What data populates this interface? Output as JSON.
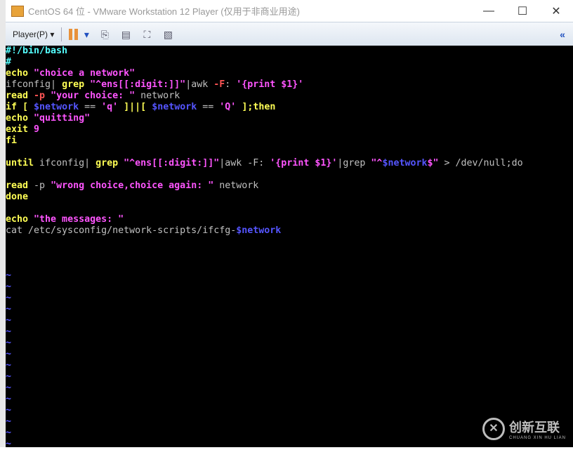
{
  "window": {
    "title": "CentOS 64 位 - VMware Workstation 12 Player (仅用于非商业用途)",
    "minimize": "—",
    "maximize": "☐",
    "close": "✕"
  },
  "toolbar": {
    "player_menu": "Player(P) ▾",
    "pause_dropdown": "▾",
    "send_keys": "⎘",
    "removable": "▤",
    "fullscreen": "⛶",
    "unity": "▧",
    "collapse": "«"
  },
  "editor": {
    "lines": [
      [
        [
          "c",
          "#!/bin/bash"
        ]
      ],
      [
        [
          "c",
          "#"
        ]
      ],
      [
        [
          "y",
          "echo "
        ],
        [
          "m",
          "\"choice a network\""
        ]
      ],
      [
        [
          "g",
          "ifconfig| "
        ],
        [
          "y",
          "grep "
        ],
        [
          "m",
          "\"^ens[[:digit:]]\""
        ],
        [
          "g",
          "|awk "
        ],
        [
          "r",
          "-F"
        ],
        [
          "g",
          ": "
        ],
        [
          "m",
          "'{print $1}'"
        ]
      ],
      [
        [
          "y",
          "read "
        ],
        [
          "r",
          "-p "
        ],
        [
          "m",
          "\"your choice: \""
        ],
        [
          "g",
          " network"
        ]
      ],
      [
        [
          "y",
          "if "
        ],
        [
          "y",
          "[ "
        ],
        [
          "b",
          "$network"
        ],
        [
          "g",
          " == "
        ],
        [
          "m",
          "'q'"
        ],
        [
          "y",
          " ]||[ "
        ],
        [
          "b",
          "$network"
        ],
        [
          "g",
          " == "
        ],
        [
          "m",
          "'Q'"
        ],
        [
          "y",
          " ];then"
        ]
      ],
      [
        [
          "y",
          "echo "
        ],
        [
          "m",
          "\"quitting\""
        ]
      ],
      [
        [
          "y",
          "exit "
        ],
        [
          "m",
          "9"
        ]
      ],
      [
        [
          "y",
          "fi"
        ]
      ],
      [],
      [
        [
          "y",
          "until "
        ],
        [
          "g",
          "ifconfig| "
        ],
        [
          "y",
          "grep "
        ],
        [
          "m",
          "\"^ens[[:digit:]]\""
        ],
        [
          "g",
          "|awk -F: "
        ],
        [
          "m",
          "'{print $1}'"
        ],
        [
          "g",
          "|grep "
        ],
        [
          "m",
          "\"^"
        ],
        [
          "b",
          "$network"
        ],
        [
          "m",
          "$\""
        ],
        [
          "g",
          " > /dev/null;do"
        ]
      ],
      [],
      [
        [
          "y",
          "read "
        ],
        [
          "g",
          "-p "
        ],
        [
          "m",
          "\"wrong choice,choice again: \""
        ],
        [
          "g",
          " network"
        ]
      ],
      [
        [
          "y",
          "done"
        ]
      ],
      [],
      [
        [
          "y",
          "echo "
        ],
        [
          "m",
          "\"the messages: \""
        ]
      ],
      [
        [
          "g",
          "cat /etc/sysconfig/network-scripts/ifcfg-"
        ],
        [
          "b",
          "$network"
        ]
      ],
      [],
      [],
      []
    ],
    "tilde": "~",
    "tilde_count": 16
  },
  "watermark": {
    "brand": "创新互联",
    "sub": "CHUANG XIN HU LIAN"
  }
}
